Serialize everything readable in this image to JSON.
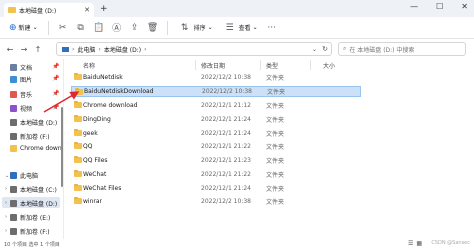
{
  "window": {
    "tab_title": "本地磁盘 (D:)",
    "tab_close": "✕",
    "new_tab": "+",
    "controls": [
      "—",
      "☐",
      "✕"
    ]
  },
  "toolbar": {
    "new_label": "新建",
    "sort_label": "排序",
    "view_label": "查看",
    "more": "···"
  },
  "address": {
    "segments": [
      "此电脑",
      "本地磁盘 (D:)"
    ],
    "separator": "›",
    "search_placeholder": "在 本地磁盘 (D:) 中搜索"
  },
  "sidebar": {
    "items": [
      {
        "label": "文档",
        "icon": "documents-icon",
        "color": "#6b7fa3"
      },
      {
        "label": "图片",
        "icon": "pictures-icon",
        "color": "#3a8fd6"
      },
      {
        "label": "音乐",
        "icon": "music-icon",
        "color": "#e0574f"
      },
      {
        "label": "视频",
        "icon": "videos-icon",
        "color": "#8a53c9"
      },
      {
        "label": "本地磁盘 (D:)",
        "icon": "drive-icon",
        "color": "#6d6d6d"
      },
      {
        "label": "新加卷 (F:)",
        "icon": "drive-icon",
        "color": "#6d6d6d"
      },
      {
        "label": "Chrome downl",
        "icon": "folder-icon",
        "color": "#f2c14e"
      },
      {
        "label": "此电脑",
        "icon": "pc-icon",
        "color": "#2f6fbf"
      },
      {
        "label": "本地磁盘 (C:)",
        "icon": "drive-icon",
        "color": "#6d6d6d"
      },
      {
        "label": "本地磁盘 (D:)",
        "icon": "drive-icon",
        "color": "#6d6d6d"
      },
      {
        "label": "新加卷 (E:)",
        "icon": "drive-icon",
        "color": "#6d6d6d"
      },
      {
        "label": "新加卷 (F:)",
        "icon": "drive-icon",
        "color": "#6d6d6d"
      }
    ]
  },
  "table": {
    "columns": [
      "名称",
      "修改日期",
      "类型",
      "大小"
    ],
    "rows": [
      {
        "name": "BaiduNetdisk",
        "date": "2022/12/2 10:38",
        "type": "文件夹"
      },
      {
        "name": "BaiduNetdiskDownload",
        "date": "2022/12/2 10:38",
        "type": "文件夹"
      },
      {
        "name": "Chrome download",
        "date": "2022/12/1 21:12",
        "type": "文件夹"
      },
      {
        "name": "DingDing",
        "date": "2022/12/1 21:24",
        "type": "文件夹"
      },
      {
        "name": "geek",
        "date": "2022/12/1 21:24",
        "type": "文件夹"
      },
      {
        "name": "QQ",
        "date": "2022/12/1 21:22",
        "type": "文件夹"
      },
      {
        "name": "QQ Files",
        "date": "2022/12/1 21:23",
        "type": "文件夹"
      },
      {
        "name": "WeChat",
        "date": "2022/12/1 21:22",
        "type": "文件夹"
      },
      {
        "name": "WeChat Files",
        "date": "2022/12/1 21:24",
        "type": "文件夹"
      },
      {
        "name": "winrar",
        "date": "2022/12/2 10:38",
        "type": "文件夹"
      }
    ]
  },
  "status": {
    "text": "10 个项目   选中 1 个项目",
    "watermark": "CSDN @Sansec"
  },
  "colors": {
    "accent": "#1e6fd0",
    "selection": "#cce0f7",
    "annotation_arrow": "#e0282e"
  }
}
